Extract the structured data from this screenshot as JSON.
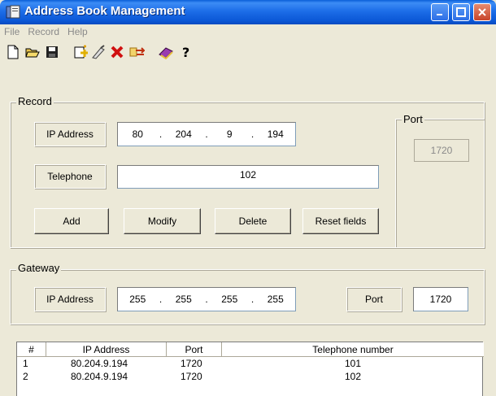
{
  "window": {
    "title": "Address Book Management"
  },
  "menu": [
    "File",
    "Record",
    "Help"
  ],
  "toolbar": {
    "icons": [
      "new-file-icon",
      "open-folder-icon",
      "save-icon",
      "add-record-icon",
      "edit-record-icon",
      "delete-record-icon",
      "transfer-icon",
      "book-icon",
      "help-icon"
    ]
  },
  "record": {
    "legend": "Record",
    "ip_label": "IP Address",
    "ip": [
      "80",
      "204",
      "9",
      "194"
    ],
    "telephone_label": "Telephone",
    "telephone": "102",
    "buttons": {
      "add": "Add",
      "modify": "Modify",
      "delete": "Delete",
      "reset": "Reset fields"
    },
    "port_legend": "Port",
    "port": "1720"
  },
  "gateway": {
    "legend": "Gateway",
    "ip_label": "IP Address",
    "ip": [
      "255",
      "255",
      "255",
      "255"
    ],
    "port_label": "Port",
    "port": "1720"
  },
  "table": {
    "headers": [
      "#",
      "IP Address",
      "Port",
      "Telephone number"
    ],
    "rows": [
      [
        "1",
        "80.204.9.194",
        "1720",
        "101"
      ],
      [
        "2",
        "80.204.9.194",
        "1720",
        "102"
      ]
    ]
  },
  "colors": {
    "titlebar": "#0a5fd8",
    "window_bg": "#ece9d8",
    "delete_icon": "#d01010"
  }
}
